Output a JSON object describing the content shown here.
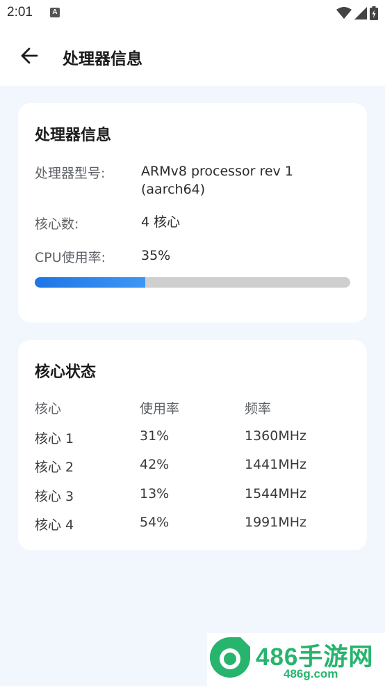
{
  "status_bar": {
    "time": "2:01",
    "notification_icon": "A"
  },
  "header": {
    "title": "处理器信息"
  },
  "processor_card": {
    "title": "处理器信息",
    "model_label": "处理器型号:",
    "model_value_line1": "ARMv8 processor rev 1",
    "model_value_line2": "(aarch64)",
    "cores_label": "核心数:",
    "cores_value": "4 核心",
    "usage_label": "CPU使用率:",
    "usage_value": "35%",
    "usage_fraction": 0.35,
    "accent_color": "#1d76e6"
  },
  "core_status_card": {
    "title": "核心状态",
    "columns": [
      "核心",
      "使用率",
      "频率"
    ],
    "rows": [
      {
        "core": "核心 1",
        "usage": "31%",
        "freq": "1360MHz"
      },
      {
        "core": "核心 2",
        "usage": "42%",
        "freq": "1441MHz"
      },
      {
        "core": "核心 3",
        "usage": "13%",
        "freq": "1544MHz"
      },
      {
        "core": "核心 4",
        "usage": "54%",
        "freq": "1991MHz"
      }
    ]
  },
  "watermark": {
    "brand": "486手游网",
    "url": "486g.com",
    "color": "#27b46d"
  }
}
